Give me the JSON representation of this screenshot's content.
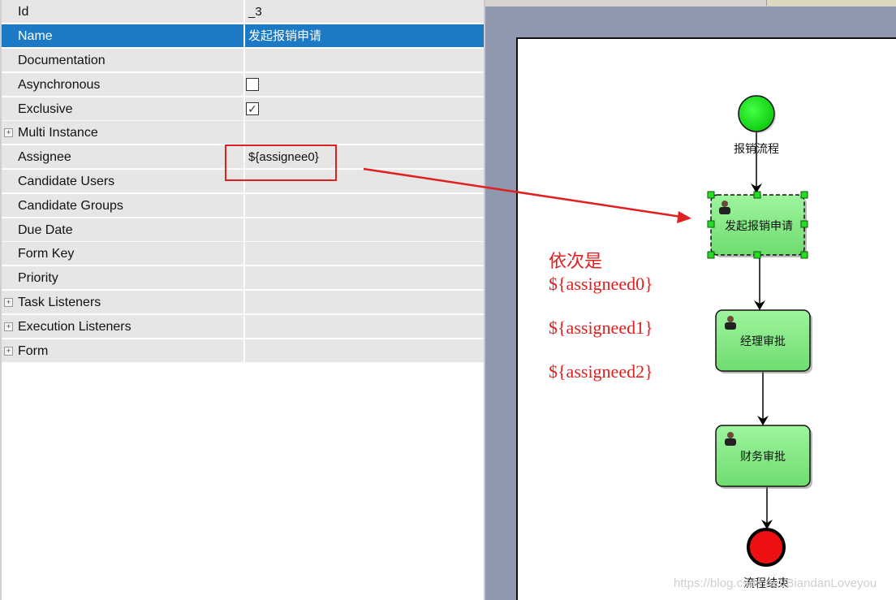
{
  "properties": {
    "rows": [
      {
        "key": "Id",
        "value": "_3"
      },
      {
        "key": "Name",
        "value": "发起报销申请",
        "selected": true
      },
      {
        "key": "Documentation",
        "value": ""
      },
      {
        "key": "Asynchronous",
        "checkbox": false
      },
      {
        "key": "Exclusive",
        "checkbox": true
      },
      {
        "key": "Multi Instance",
        "expandable": true
      },
      {
        "key": "Assignee",
        "value": "${assignee0}"
      },
      {
        "key": "Candidate Users",
        "value": ""
      },
      {
        "key": "Candidate Groups",
        "value": ""
      },
      {
        "key": "Due Date",
        "value": ""
      },
      {
        "key": "Form Key",
        "value": ""
      },
      {
        "key": "Priority",
        "value": ""
      },
      {
        "key": "Task Listeners",
        "expandable": true
      },
      {
        "key": "Execution Listeners",
        "expandable": true
      },
      {
        "key": "Form",
        "expandable": true
      }
    ]
  },
  "diagram": {
    "start_event": {
      "label": "报销流程",
      "color": "#22dd22"
    },
    "tasks": [
      {
        "label": "发起报销申请",
        "selected": true
      },
      {
        "label": "经理审批"
      },
      {
        "label": "财务审批"
      }
    ],
    "end_event": {
      "label": "流程结束",
      "color": "#ee1111"
    },
    "task_color": "#88ee88"
  },
  "annotation": {
    "title": "依次是",
    "lines": [
      "${assigneed0}",
      "${assigneed1}",
      "${assigneed2}"
    ],
    "color": "#e02020"
  },
  "watermark": "https://blog.csdn.net/BiandanLoveyou"
}
